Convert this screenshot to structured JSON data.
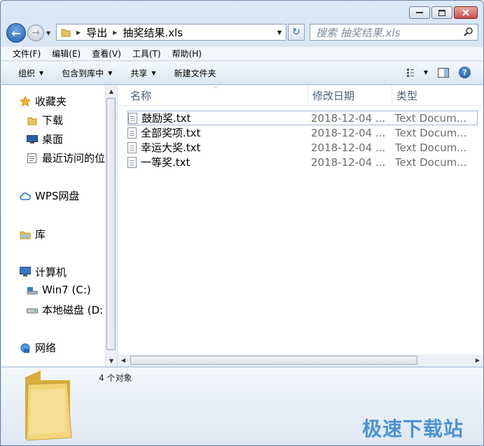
{
  "nav": {
    "path_parts": [
      "导出",
      "抽奖结果.xls"
    ]
  },
  "search": {
    "placeholder": "搜索 抽奖结果.xls"
  },
  "menu": [
    "文件(F)",
    "编辑(E)",
    "查看(V)",
    "工具(T)",
    "帮助(H)"
  ],
  "toolbar": {
    "organize": "组织",
    "include": "包含到库中",
    "share": "共享",
    "new_folder": "新建文件夹"
  },
  "sidebar": {
    "favorites": "收藏夹",
    "downloads": "下载",
    "desktop": "桌面",
    "recent": "最近访问的位",
    "wps": "WPS网盘",
    "libraries": "库",
    "computer": "计算机",
    "win7": "Win7 (C:)",
    "local": "本地磁盘 (D:",
    "network": "网络"
  },
  "columns": {
    "name": "名称",
    "date": "修改日期",
    "type": "类型"
  },
  "files": [
    {
      "name": "鼓励奖.txt",
      "date": "2018-12-04 ...",
      "type": "Text Docum..."
    },
    {
      "name": "全部奖项.txt",
      "date": "2018-12-04 ...",
      "type": "Text Docum..."
    },
    {
      "name": "幸运大奖.txt",
      "date": "2018-12-04 ...",
      "type": "Text Docum..."
    },
    {
      "name": "一等奖.txt",
      "date": "2018-12-04 ...",
      "type": "Text Docum..."
    }
  ],
  "status": {
    "count": "4 个对象"
  },
  "watermark": "极速下载站",
  "colors": {
    "accent": "#2f6bb7",
    "folder": "#e8c25a"
  }
}
